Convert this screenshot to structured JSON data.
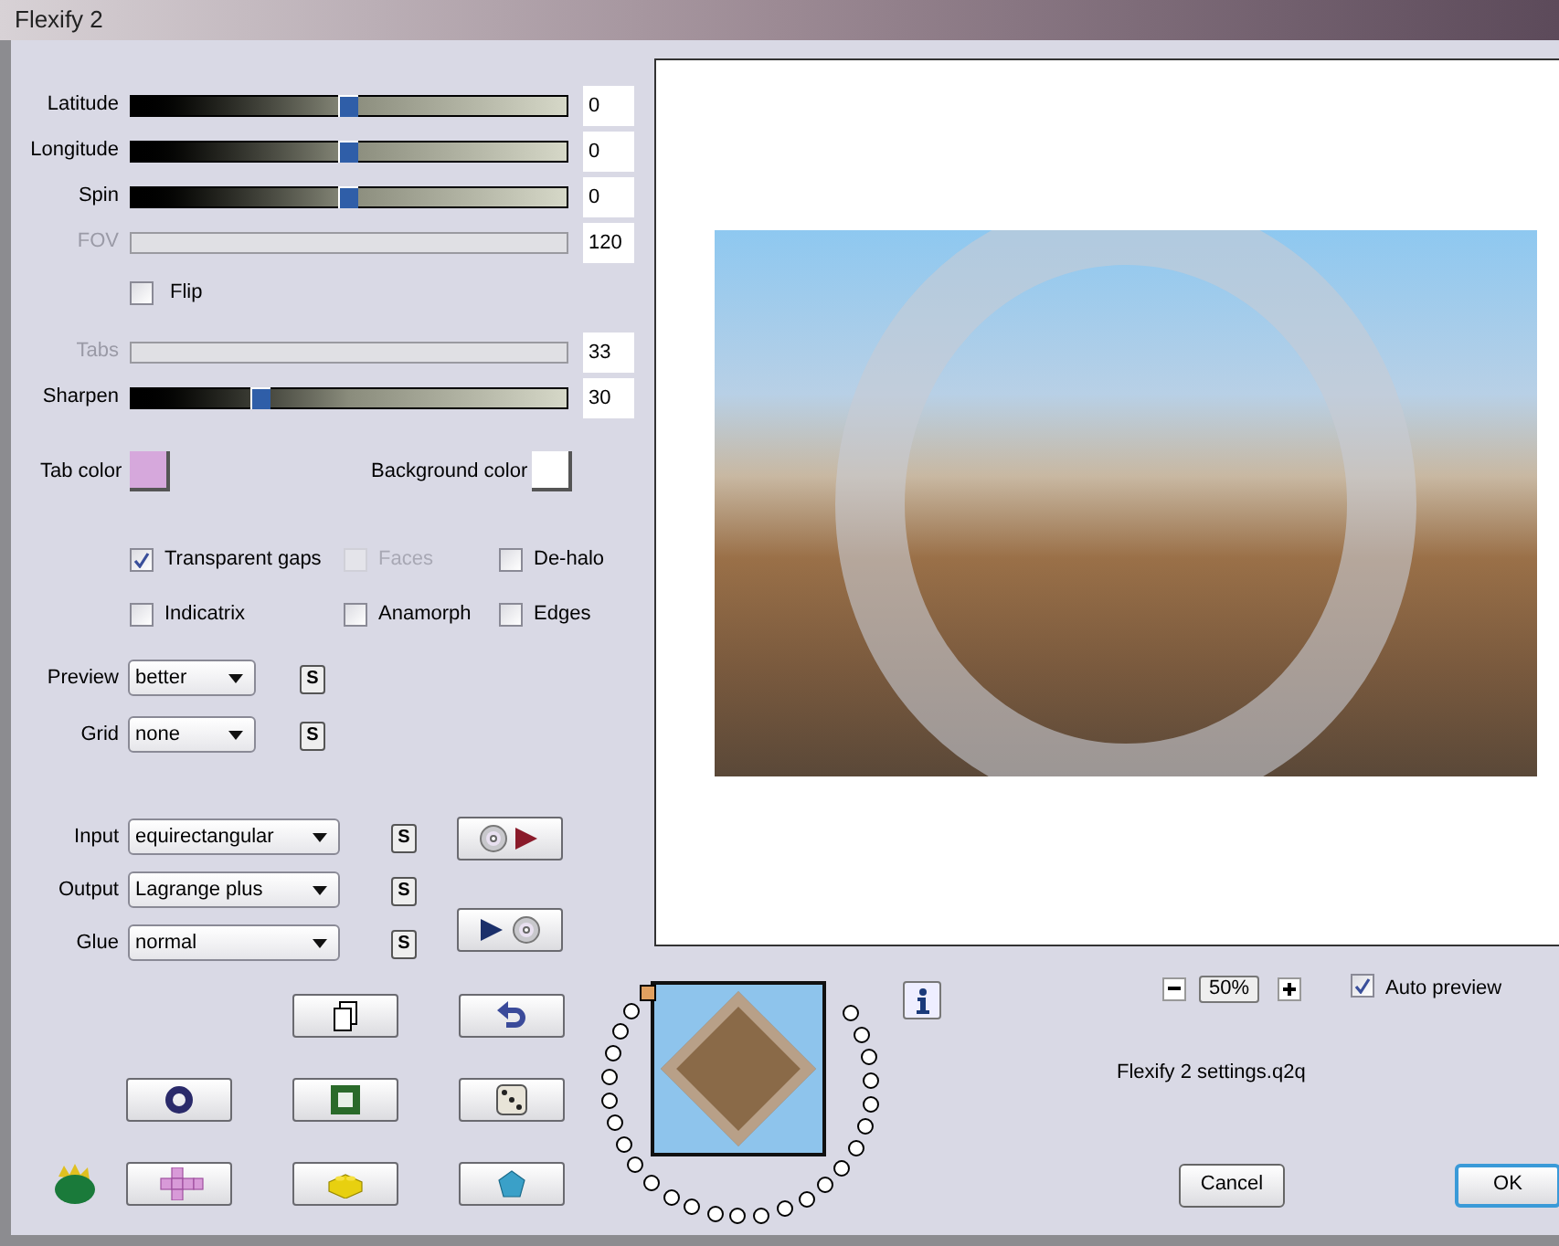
{
  "window": {
    "title": "Flexify 2"
  },
  "sliders_top": [
    {
      "label": "Latitude",
      "value": "0",
      "disabled": false,
      "level": 0.5
    },
    {
      "label": "Longitude",
      "value": "0",
      "disabled": false,
      "level": 0.5
    },
    {
      "label": "Spin",
      "value": "0",
      "disabled": false,
      "level": 0.5
    },
    {
      "label": "FOV",
      "value": "120",
      "disabled": true
    }
  ],
  "flip": {
    "label": "Flip",
    "checked": false
  },
  "sliders_bottom": [
    {
      "label": "Tabs",
      "value": "33",
      "disabled": true
    },
    {
      "label": "Sharpen",
      "value": "30",
      "disabled": false,
      "level": 0.3
    }
  ],
  "colors": [
    {
      "label": "Tab color",
      "color": "#d6a8dc"
    },
    {
      "label": "Background color",
      "color": "#ffffff"
    }
  ],
  "options": [
    [
      {
        "label": "Transparent gaps",
        "checked": true,
        "disabled": false
      },
      {
        "label": "Faces",
        "checked": false,
        "disabled": true
      },
      {
        "label": "De-halo",
        "checked": false,
        "disabled": false
      }
    ],
    [
      {
        "label": "Indicatrix",
        "checked": false,
        "disabled": false
      },
      {
        "label": "Anamorph",
        "checked": false,
        "disabled": false
      },
      {
        "label": "Edges",
        "checked": false,
        "disabled": false
      }
    ]
  ],
  "view_dropdowns": [
    {
      "label": "Preview",
      "value": "better",
      "save": "S"
    },
    {
      "label": "Grid",
      "value": "none",
      "save": "S"
    }
  ],
  "mapping_dropdowns": [
    {
      "label": "Input",
      "value": "equirectangular",
      "save": "S"
    },
    {
      "label": "Output",
      "value": "Lagrange plus",
      "save": "S"
    },
    {
      "label": "Glue",
      "value": "normal",
      "save": "S"
    }
  ],
  "presets": [
    {
      "selected": true
    },
    {
      "selected": false
    },
    {
      "selected": false
    },
    {
      "selected": false
    },
    {
      "selected": false
    },
    {
      "selected": false
    },
    {
      "selected": false
    },
    {
      "selected": false
    },
    {
      "selected": false
    },
    {
      "selected": false
    },
    {
      "selected": false
    },
    {
      "selected": false
    },
    {
      "selected": false
    },
    {
      "selected": false
    },
    {
      "selected": false
    },
    {
      "selected": false
    },
    {
      "selected": false
    },
    {
      "selected": false
    },
    {
      "selected": false
    },
    {
      "selected": false
    },
    {
      "selected": false
    },
    {
      "selected": false
    },
    {
      "selected": false
    },
    {
      "selected": false
    },
    {
      "selected": false
    },
    {
      "selected": false
    }
  ],
  "zoom": {
    "value": "50%"
  },
  "auto_preview": {
    "label": "Auto preview",
    "checked": true
  },
  "settings_file": "Flexify 2 settings.q2q",
  "buttons": [
    {
      "label": "Cancel",
      "default": false
    },
    {
      "label": "OK",
      "default": true
    }
  ]
}
